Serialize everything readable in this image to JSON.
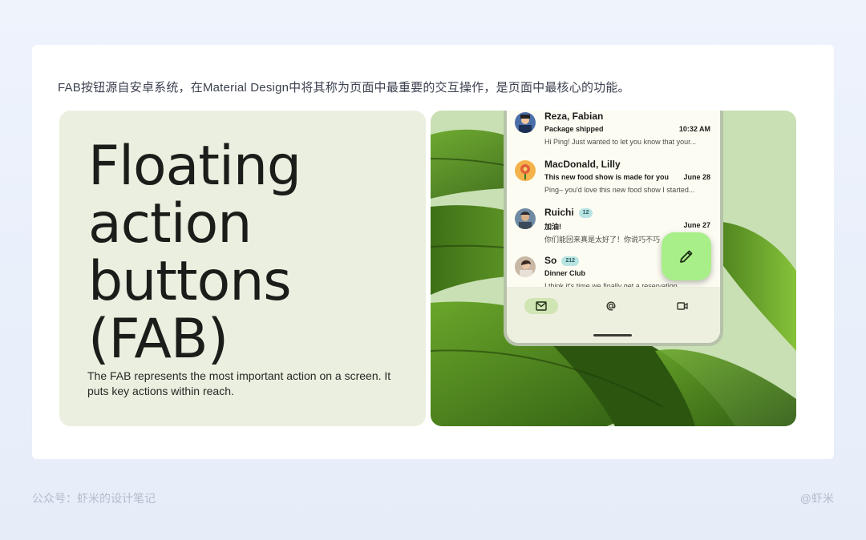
{
  "caption": "FAB按钮源自安卓系统，在Material Design中将其称为页面中最重要的交互操作，是页面中最核心的功能。",
  "hero": {
    "title_lines": [
      "Floating",
      "action",
      "buttons",
      "(FAB)"
    ],
    "description": "The FAB represents the most important action on a screen. It puts key actions within reach."
  },
  "inbox": [
    {
      "sender": "Reza, Fabian",
      "badge": "",
      "subject": "Package shipped",
      "time": "10:32 AM",
      "preview": "Hi Ping! Just wanted to let you know that your..."
    },
    {
      "sender": "MacDonald, Lilly",
      "badge": "",
      "subject": "This new food show is made for you",
      "time": "June 28",
      "preview": "Ping– you'd love this new food show I started..."
    },
    {
      "sender": "Ruichi",
      "badge": "12",
      "subject": "加油!",
      "time": "June 27",
      "preview": "你们能回来真是太好了！你说巧不巧"
    },
    {
      "sender": "So",
      "badge": "212",
      "subject": "Dinner Club",
      "time": "",
      "preview": "I think it's time we finally get a reservation..."
    }
  ],
  "nav": {
    "items": [
      {
        "icon": "mail-icon",
        "active": true
      },
      {
        "icon": "at-sign-icon",
        "active": false
      },
      {
        "icon": "video-icon",
        "active": false
      }
    ]
  },
  "fab": {
    "icon": "pencil-icon",
    "color": "#a8ef8a"
  },
  "footer": {
    "left": "公众号：虾米的设计笔记",
    "right": "@虾米"
  },
  "colors": {
    "left_panel": "#eaefdf",
    "right_panel": "#c9e0b4",
    "leaf": "#4f8a1e"
  }
}
